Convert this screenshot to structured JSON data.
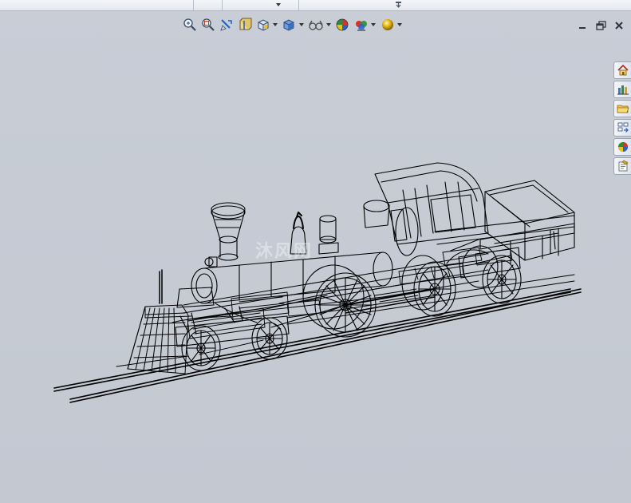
{
  "top_strip": {
    "dropdown_icon": "chevron-down-icon",
    "handle_icon": "pane-handle-icon"
  },
  "view_toolbar": {
    "buttons": [
      {
        "icon": "zoom-to-fit-icon"
      },
      {
        "icon": "zoom-to-area-icon"
      },
      {
        "icon": "previous-view-icon"
      },
      {
        "icon": "section-view-icon"
      },
      {
        "icon": "view-orientation-icon",
        "dropdown": true
      },
      {
        "icon": "display-style-icon",
        "dropdown": true
      },
      {
        "icon": "hide-show-items-icon",
        "dropdown": true
      },
      {
        "icon": "edit-appearance-icon"
      },
      {
        "icon": "apply-scene-icon",
        "dropdown": true
      },
      {
        "icon": "view-settings-icon",
        "dropdown": true
      }
    ]
  },
  "window_controls": {
    "minimize_icon": "minimize-icon",
    "restore_icon": "restore-icon",
    "close_icon": "close-icon"
  },
  "task_pane": {
    "tabs": [
      {
        "icon": "home-icon",
        "name": "solidworks-resources"
      },
      {
        "icon": "design-library-icon",
        "name": "design-library"
      },
      {
        "icon": "folder-icon",
        "name": "file-explorer"
      },
      {
        "icon": "view-palette-icon",
        "name": "view-palette"
      },
      {
        "icon": "appearances-icon",
        "name": "appearances-scenes-decals"
      },
      {
        "icon": "custom-properties-icon",
        "name": "custom-properties"
      }
    ]
  },
  "graphics": {
    "model": "steam-locomotive-wireframe",
    "watermark_text": "沐风网",
    "colors": {
      "background": "#c5cad3",
      "wireframe": "#000000"
    }
  }
}
